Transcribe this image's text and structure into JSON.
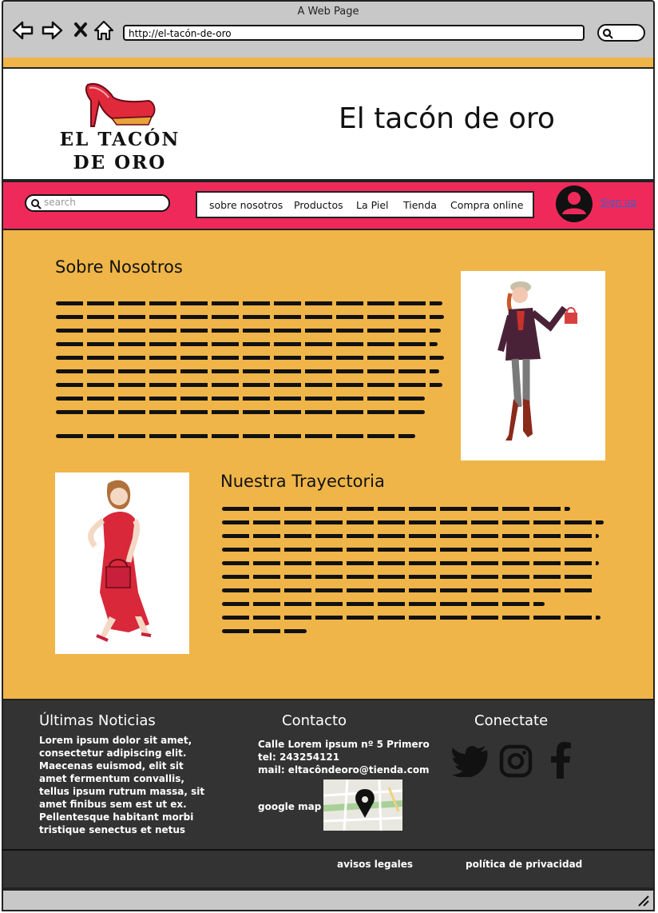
{
  "browser": {
    "title": "A Web Page",
    "url": "http://el-tacón-de-oro"
  },
  "header": {
    "logo_text": "EL TACÓN DE ORO",
    "site_title": "El tacón de oro"
  },
  "nav": {
    "search_placeholder": "search",
    "items": [
      "sobre nosotros",
      "Productos",
      "La Piel",
      "Tienda",
      "Compra online"
    ],
    "signup": "Sign up"
  },
  "about": {
    "heading": "Sobre Nosotros"
  },
  "history": {
    "heading": "Nuestra Trayectoria"
  },
  "footer": {
    "news_heading": "Últimas Noticias",
    "news_text": "Lorem ipsum dolor sit amet, consectetur adipiscing elit. Maecenas euismod, elit sit amet fermentum convallis, tellus ipsum rutrum massa, sit amet finibus sem est ut ex. Pellentesque habitant morbi tristique senectus et netus",
    "contact_heading": "Contacto",
    "address": "Calle Lorem ipsum nº 5 Primero",
    "phone": "tel: 243254121",
    "mail": "mail: eltacôndeoro@tienda.com",
    "map_label": "google map",
    "connect_heading": "Conectate",
    "legal": "avisos legales",
    "privacy": "política de privacidad"
  },
  "colors": {
    "gold": "#efb548",
    "pink": "#ef2a5b",
    "footer": "#333333",
    "link": "#3a5fd0"
  }
}
